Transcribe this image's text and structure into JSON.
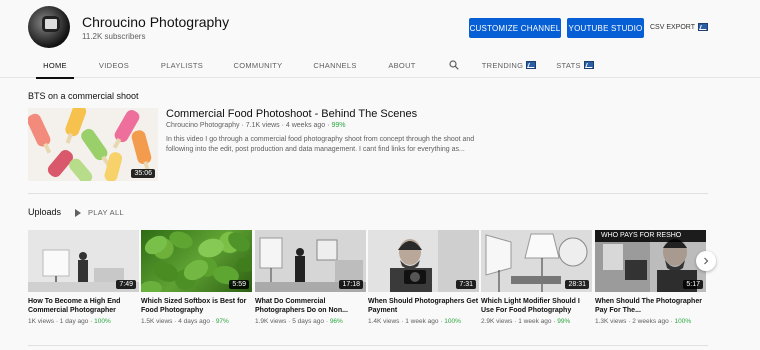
{
  "channel": {
    "name": "Chroucino Photography",
    "subscribers": "11.2K subscribers"
  },
  "actions": {
    "customize": "CUSTOMIZE CHANNEL",
    "studio": "YOUTUBE STUDIO",
    "csv_export": "CSV EXPORT"
  },
  "tabs": [
    "HOME",
    "VIDEOS",
    "PLAYLISTS",
    "COMMUNITY",
    "CHANNELS",
    "ABOUT",
    "TRENDING",
    "STATS"
  ],
  "featured": {
    "section_title": "BTS on a commercial shoot",
    "title": "Commercial Food Photoshoot - Behind The Scenes",
    "channel": "Chroucino Photography",
    "views": "7.1K views",
    "age": "4 weeks ago",
    "pct": "99%",
    "duration": "35:06",
    "description": "In this video I go through a commercial food photography shoot from concept through the shoot and following into the edit, post production and data management. I cant find links for everything as..."
  },
  "uploads": {
    "title": "Uploads",
    "play_all": "PLAY ALL",
    "videos": [
      {
        "title": "How To Become a High End Commercial Photographer",
        "views": "1K views",
        "age": "1 day ago",
        "pct": "100%",
        "duration": "7:49"
      },
      {
        "title": "Which Sized Softbox is Best for Food Photography",
        "views": "1.5K views",
        "age": "4 days ago",
        "pct": "97%",
        "duration": "5:59"
      },
      {
        "title": "What Do Commercial Photographers Do on Non...",
        "views": "1.9K views",
        "age": "5 days ago",
        "pct": "96%",
        "duration": "17:18"
      },
      {
        "title": "When Should Photographers Get Payment",
        "views": "1.4K views",
        "age": "1 week ago",
        "pct": "100%",
        "duration": "7:31"
      },
      {
        "title": "Which Light Modifier Should I Use For Food Photography",
        "views": "2.9K views",
        "age": "1 week ago",
        "pct": "99%",
        "duration": "28:31"
      },
      {
        "title": "When Should The Photographer Pay For The...",
        "views": "1.3K views",
        "age": "2 weeks ago",
        "pct": "100%",
        "duration": "5:17",
        "overlay": "WHO PAYS FOR RESHO"
      }
    ]
  },
  "colors": {
    "accent": "#065fd4",
    "positive": "#2ba640"
  }
}
